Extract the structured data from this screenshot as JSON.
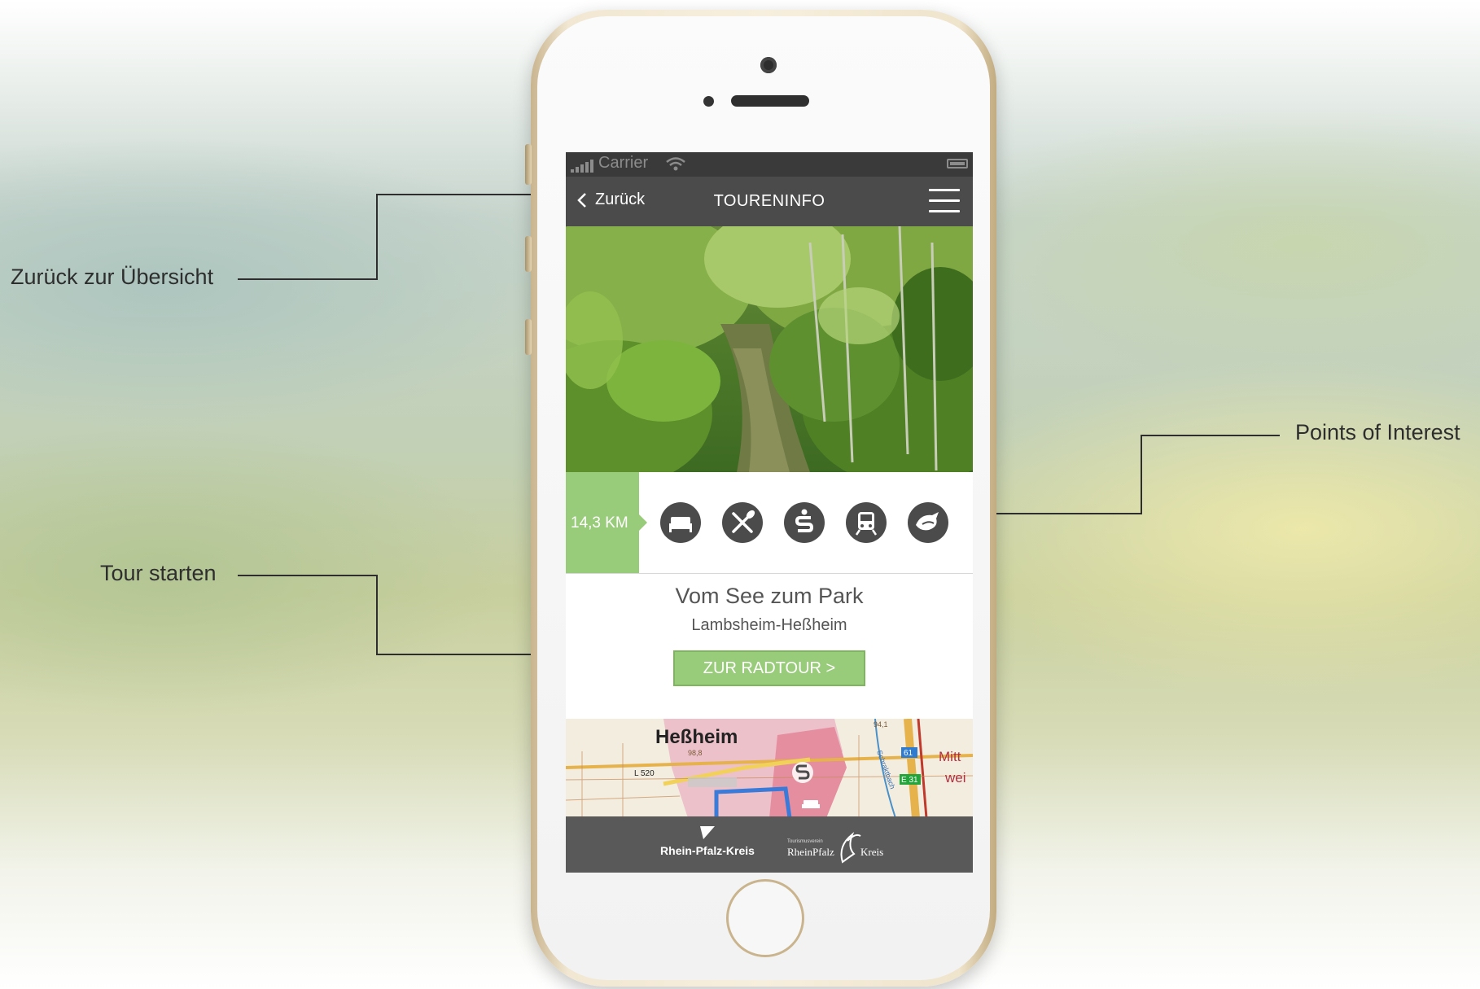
{
  "callouts": {
    "back": "Zurück zur Übersicht",
    "poi": "Points of Interest",
    "start": "Tour starten"
  },
  "statusbar": {
    "carrier": "Carrier"
  },
  "navbar": {
    "back_label": "Zurück",
    "title": "TOURENINFO"
  },
  "tour": {
    "distance": "14,3 KM",
    "title": "Vom See zum Park",
    "subtitle": "Lambsheim-Heßheim",
    "button_label": "ZUR RADTOUR >"
  },
  "poi_icons": [
    "bed-icon",
    "restaurant-icon",
    "bank-icon",
    "train-icon",
    "bird-icon"
  ],
  "map": {
    "town": "Heßheim",
    "road_label": "L 520",
    "elev_1": "98,8",
    "elev_2": "94,1",
    "route_badge_1": "61",
    "route_badge_2": "E 31",
    "place_partial_1": "Mitt",
    "place_partial_2": "wei",
    "stream": "Schraktbach"
  },
  "footer": {
    "logo1": "Rhein-Pfalz-Kreis",
    "logo2_small": "Tourismusverein",
    "logo2_main": "RheinPfalz",
    "logo2_kreis": "Kreis"
  },
  "colors": {
    "accent_green": "#99cc7a",
    "nav_dark": "#4b4b4b",
    "status_dark": "#3a3a3a",
    "footer": "#595959"
  }
}
